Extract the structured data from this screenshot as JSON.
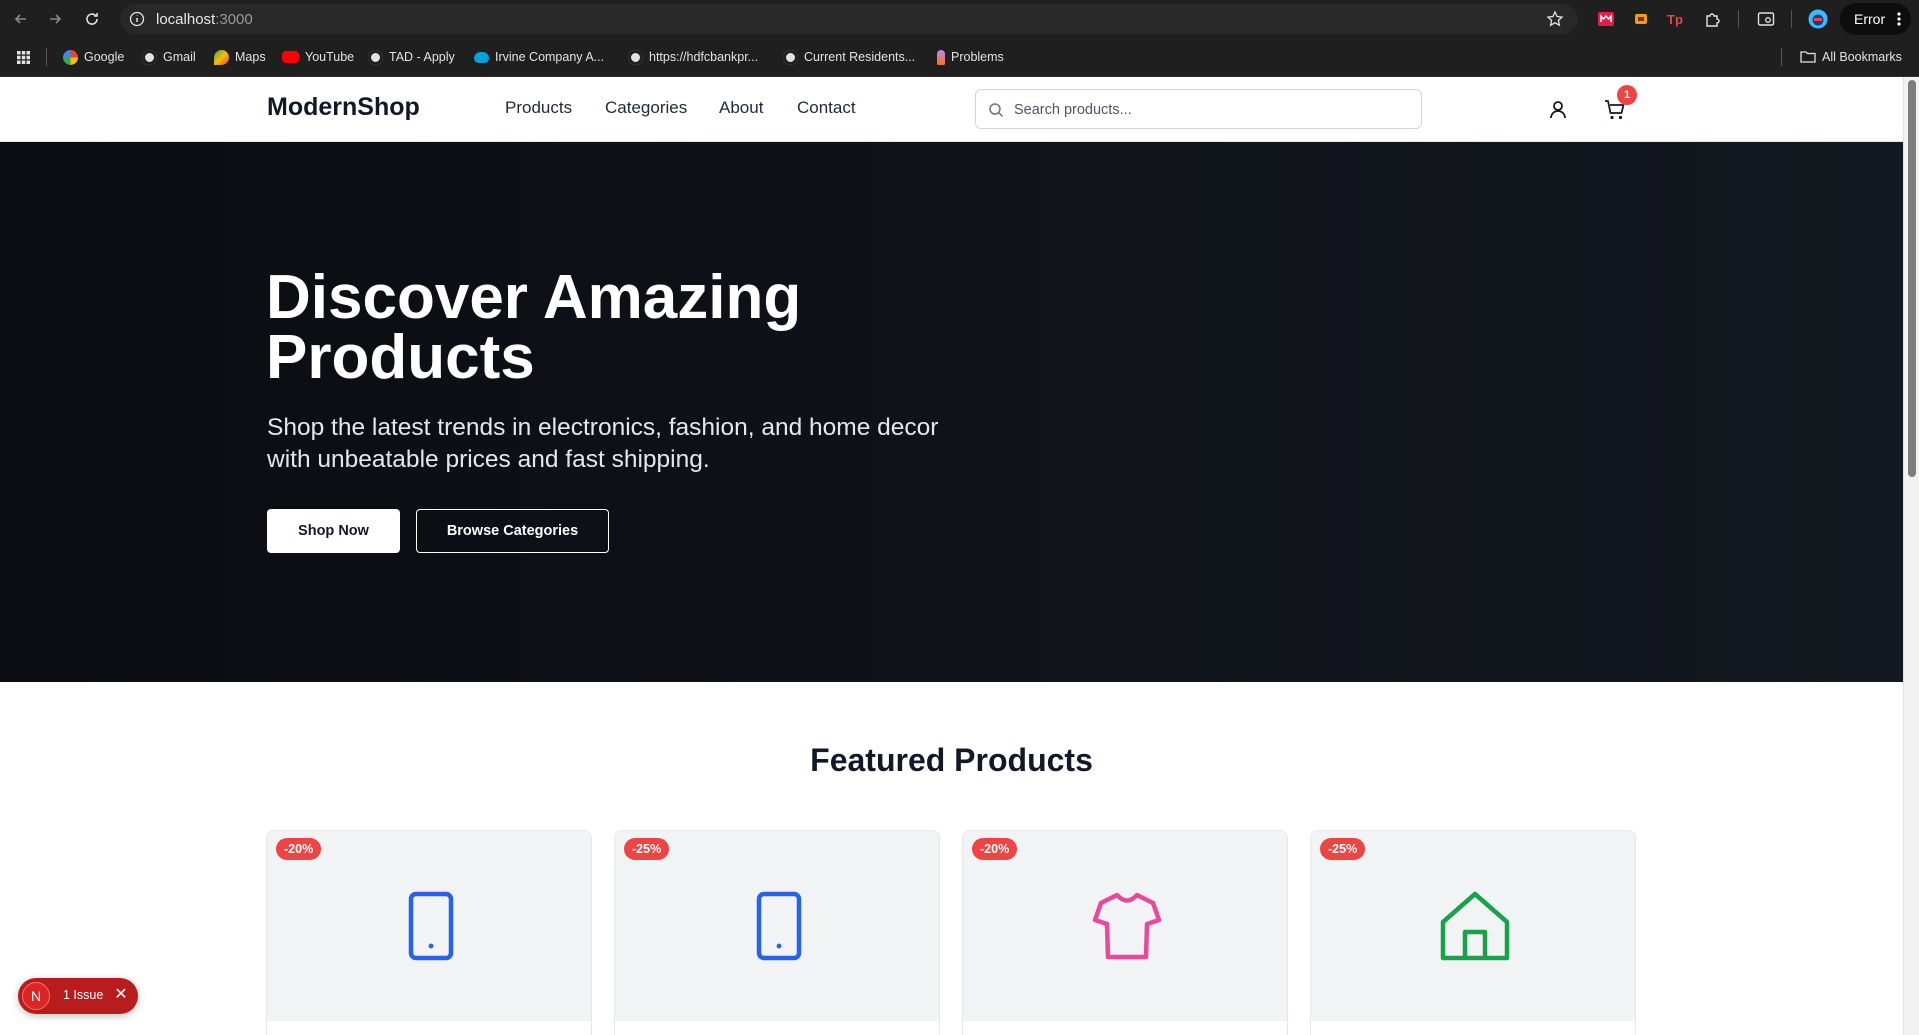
{
  "browser": {
    "url_host": "localhost",
    "url_port": ":3000",
    "error_label": "Error",
    "all_bookmarks": "All Bookmarks",
    "bookmarks": [
      {
        "label": "Google",
        "icon": "google-icon"
      },
      {
        "label": "Gmail",
        "icon": "globe-icon"
      },
      {
        "label": "Maps",
        "icon": "maps-icon"
      },
      {
        "label": "YouTube",
        "icon": "youtube-icon"
      },
      {
        "label": "TAD - Apply",
        "icon": "globe-icon"
      },
      {
        "label": "Irvine Company A...",
        "icon": "salesforce-icon"
      },
      {
        "label": "https://hdfcbankpr...",
        "icon": "globe-icon"
      },
      {
        "label": "Current Residents...",
        "icon": "globe-icon"
      },
      {
        "label": "Problems",
        "icon": "rocket-icon"
      }
    ]
  },
  "header": {
    "logo": "ModernShop",
    "nav": [
      "Products",
      "Categories",
      "About",
      "Contact"
    ],
    "search_placeholder": "Search products...",
    "cart_count": "1"
  },
  "hero": {
    "title": "Discover Amazing Products",
    "subtitle": "Shop the latest trends in electronics, fashion, and home decor with unbeatable prices and fast shipping.",
    "primary_button": "Shop Now",
    "secondary_button": "Browse Categories"
  },
  "featured": {
    "title": "Featured Products",
    "cards": [
      {
        "discount": "-20%",
        "icon": "tablet-icon",
        "color": "#2563eb"
      },
      {
        "discount": "-25%",
        "icon": "tablet-icon",
        "color": "#2563eb"
      },
      {
        "discount": "-20%",
        "icon": "shirt-icon",
        "color": "#ec4899"
      },
      {
        "discount": "-25%",
        "icon": "home-icon",
        "color": "#16a34a"
      }
    ]
  },
  "devtools": {
    "issue_label": "1 Issue",
    "logo_letter": "N"
  }
}
